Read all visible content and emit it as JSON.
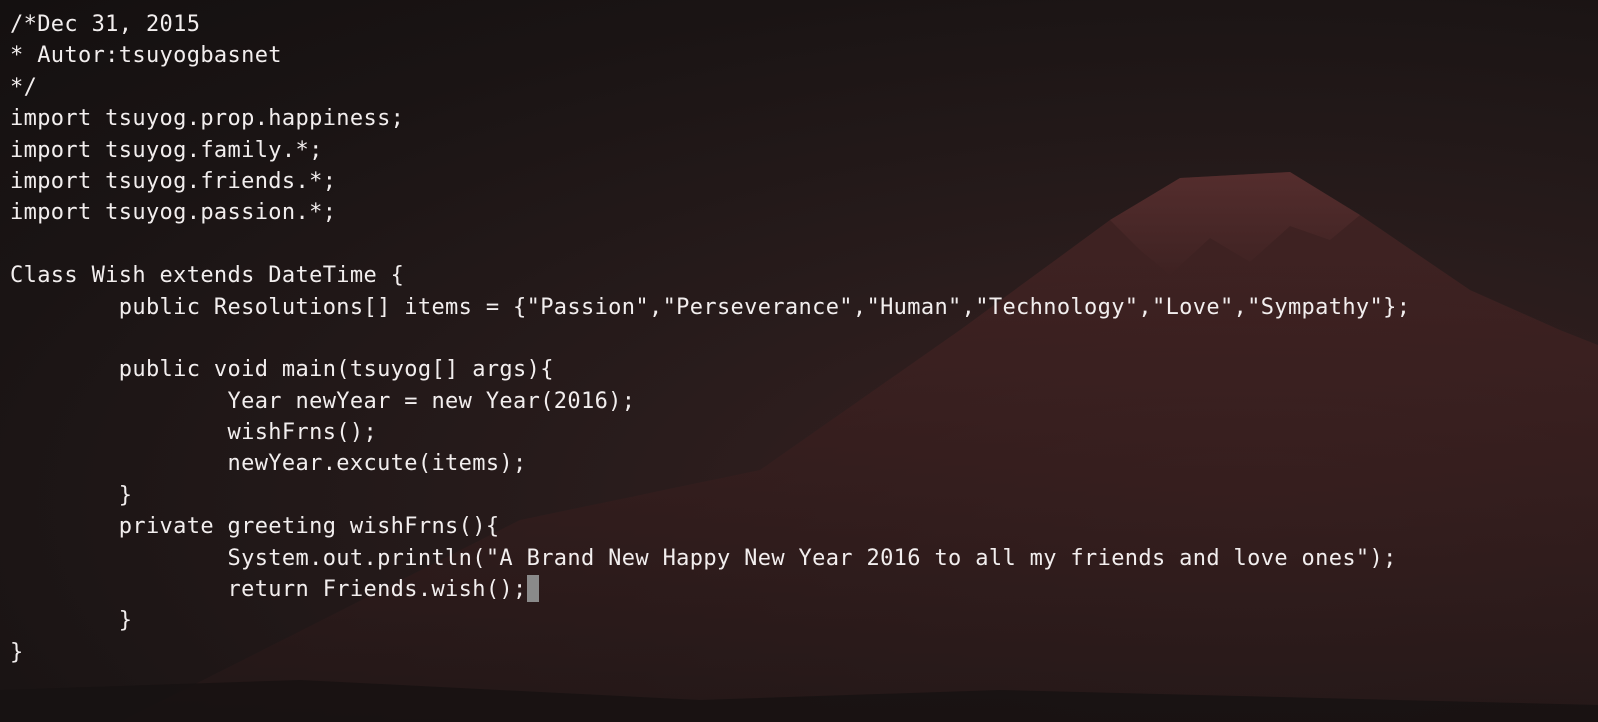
{
  "editor": {
    "lines": [
      "/*Dec 31, 2015",
      "* Autor:tsuyogbasnet",
      "*/",
      "import tsuyog.prop.happiness;",
      "import tsuyog.family.*;",
      "import tsuyog.friends.*;",
      "import tsuyog.passion.*;",
      "",
      "Class Wish extends DateTime {",
      "        public Resolutions[] items = {\"Passion\",\"Perseverance\",\"Human\",\"Technology\",\"Love\",\"Sympathy\"};",
      "",
      "        public void main(tsuyog[] args){",
      "                Year newYear = new Year(2016);",
      "                wishFrns();",
      "                newYear.excute(items);",
      "        }",
      "        private greeting wishFrns(){",
      "                System.out.println(\"A Brand New Happy New Year 2016 to all my friends and love ones\");",
      "                return Friends.wish();",
      "        }",
      "}"
    ],
    "cursor_line": 19
  },
  "colors": {
    "text": "#f2eeee",
    "cursor": "#8a8a8a",
    "background": "#1e1616",
    "mountain": "#3c2020"
  }
}
